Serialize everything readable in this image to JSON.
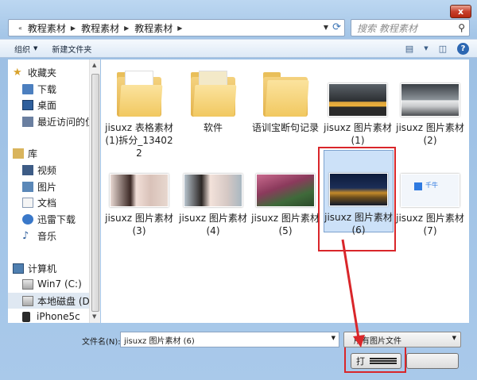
{
  "window": {
    "close_label": "x"
  },
  "address": {
    "crumbs": [
      "教程素材",
      "教程素材",
      "教程素材"
    ],
    "search_placeholder": "搜索 教程素材"
  },
  "toolbar": {
    "organize": "组织",
    "new_folder": "新建文件夹"
  },
  "nav": {
    "favorites": "收藏夹",
    "downloads": "下载",
    "desktop": "桌面",
    "recent": "最近访问的位",
    "libraries": "库",
    "videos": "视频",
    "pictures": "图片",
    "documents": "文档",
    "thunder": "迅雷下载",
    "music": "音乐",
    "computer": "计算机",
    "win7": "Win7 (C:)",
    "local_disk": "本地磁盘 (D:",
    "iphone": "iPhone5c"
  },
  "files": [
    {
      "label": "jisuxz 表格素材 (1)拆分_134022",
      "kind": "folder"
    },
    {
      "label": "软件",
      "kind": "folder"
    },
    {
      "label": "语训宝断句记录",
      "kind": "folder"
    },
    {
      "label": "jisuxz 图片素材 (1)",
      "kind": "photo"
    },
    {
      "label": "jisuxz 图片素材 (2)",
      "kind": "photo"
    },
    {
      "label": "jisuxz 图片素材 (3)",
      "kind": "photo"
    },
    {
      "label": "jisuxz 图片素材 (4)",
      "kind": "photo"
    },
    {
      "label": "jisuxz 图片素材 (5)",
      "kind": "photo"
    },
    {
      "label": "jisuxz 图片素材 (6)",
      "kind": "photo",
      "selected": true
    },
    {
      "label": "jisuxz 图片素材 (7)",
      "kind": "photo"
    }
  ],
  "thumb_text_7": "千牛",
  "bottom": {
    "filename_label": "文件名(N):",
    "filename_value": "jisuxz 图片素材 (6)",
    "filetype_value": "所有图片文件",
    "open_label": "打"
  },
  "colors": {
    "highlight_red": "#d9262a",
    "selection": "#cce1f8"
  }
}
